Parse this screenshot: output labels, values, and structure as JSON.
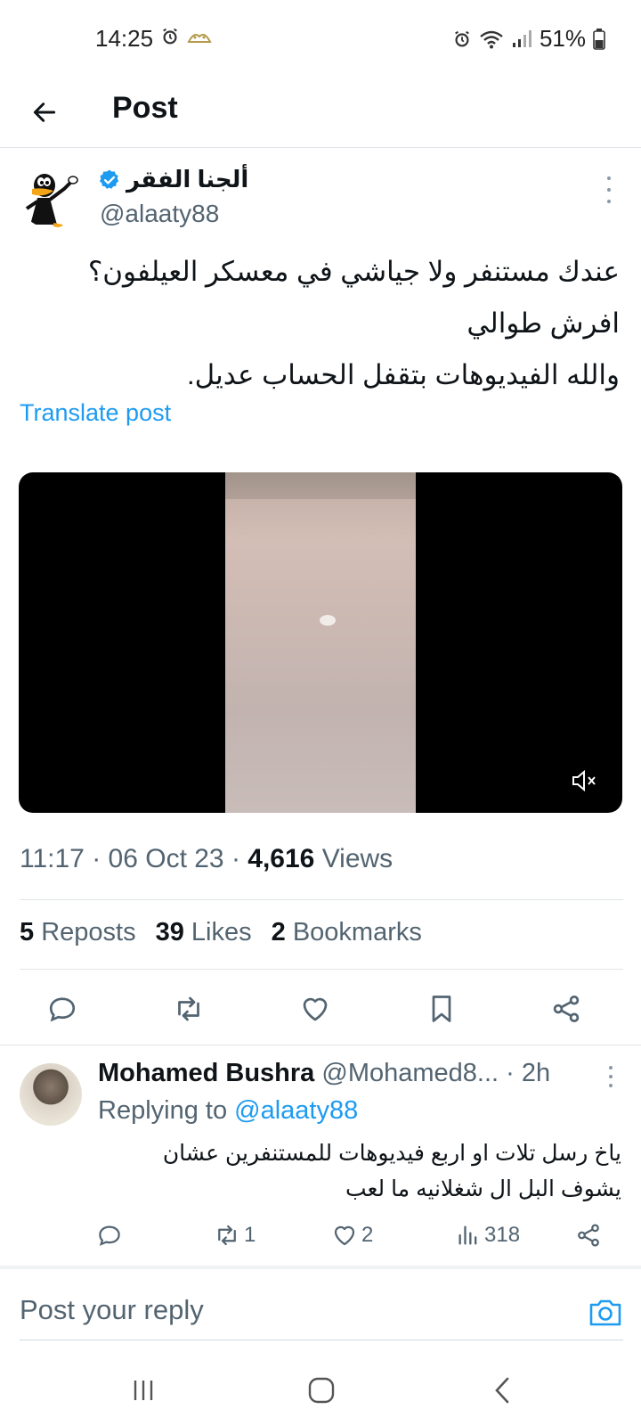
{
  "status_bar": {
    "time": "14:25",
    "battery": "51%",
    "icons": [
      "alarm-icon",
      "notification-app-icon",
      "alarm-icon",
      "wifi-icon",
      "signal-icon",
      "battery-icon"
    ]
  },
  "app_bar": {
    "title": "Post",
    "back_icon": "arrow-left-icon"
  },
  "post": {
    "author_name": "ألجنا الفقر",
    "verified": true,
    "handle": "@alaaty88",
    "lines": [
      "عندك مستنفر ولا جياشي في معسكر العيلفون؟",
      "افرش طوالي",
      "والله الفيديوهات بتقفل الحساب عديل."
    ],
    "translate_label": "Translate post",
    "media": {
      "type": "video",
      "muted": true
    },
    "time": "11:17",
    "date": "06 Oct 23",
    "views_count": "4,616",
    "views_label": "Views",
    "reposts_count": "5",
    "reposts_label": "Reposts",
    "likes_count": "39",
    "likes_label": "Likes",
    "bookmarks_count": "2",
    "bookmarks_label": "Bookmarks"
  },
  "reply": {
    "name": "Mohamed Bushra",
    "handle": "@Mohamed8...",
    "time": "· 2h",
    "replying_prefix": "Replying to",
    "replying_handle": "@alaaty88",
    "lines": [
      "ياخ رسل تلات او اربع فيديوهات للمستنفرين عشان",
      "يشوف البل ال شغلانيه ما لعب"
    ],
    "reposts": "1",
    "likes": "2",
    "views": "318"
  },
  "composer": {
    "placeholder": "Post your reply"
  },
  "colors": {
    "accent": "#1d9bf0",
    "secondary_text": "#536471",
    "primary_text": "#0f1419",
    "divider": "#e1e4e8"
  }
}
